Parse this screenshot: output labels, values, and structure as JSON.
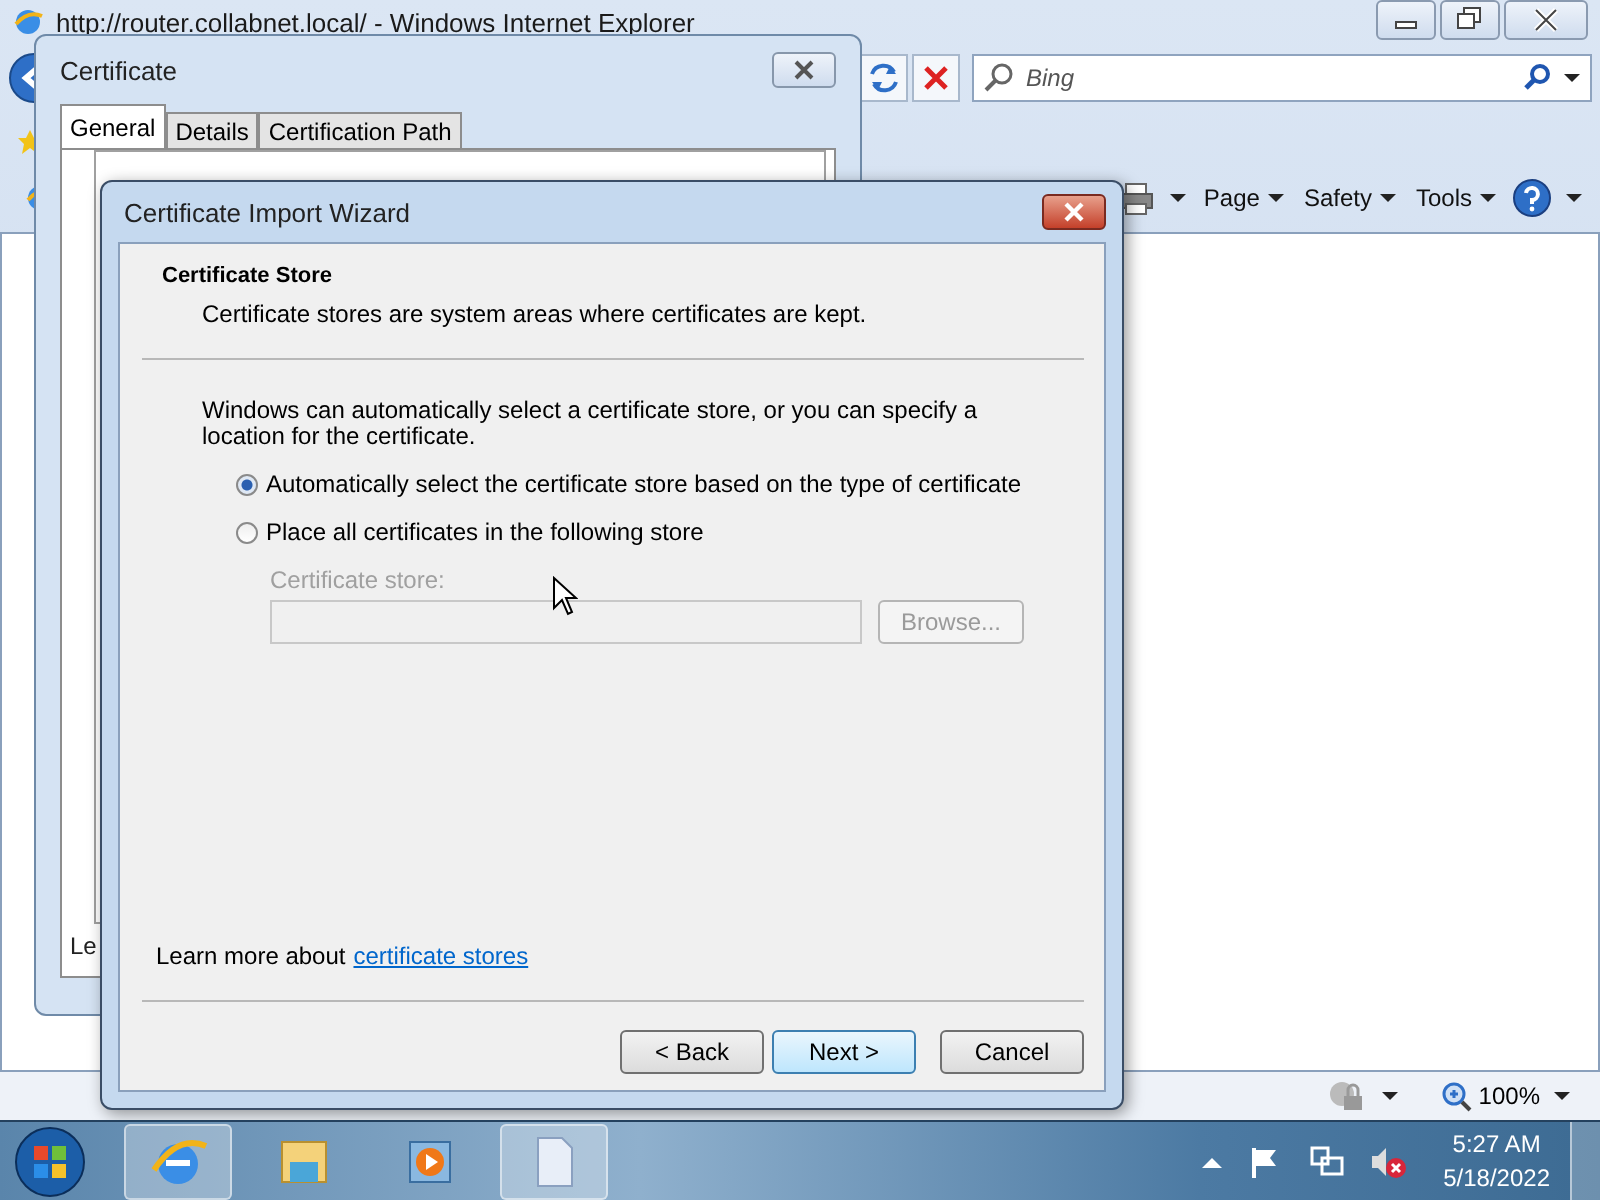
{
  "browser": {
    "title": "http://router.collabnet.local/ - Windows Internet Explorer",
    "search": {
      "placeholder": "Bing"
    },
    "commands": [
      {
        "label": "Page"
      },
      {
        "label": "Safety"
      },
      {
        "label": "Tools"
      }
    ],
    "zoom": "100%"
  },
  "certificate_dialog": {
    "title": "Certificate",
    "tabs": [
      {
        "label": "General",
        "selected": true
      },
      {
        "label": "Details",
        "selected": false
      },
      {
        "label": "Certification Path",
        "selected": false
      }
    ],
    "partial_text": "Le"
  },
  "wizard": {
    "title": "Certificate Import Wizard",
    "heading": "Certificate Store",
    "subtitle": "Certificate stores are system areas where certificates are kept.",
    "description": "Windows can automatically select a certificate store, or you can specify a location for the certificate.",
    "options": [
      {
        "label": "Automatically select the certificate store based on the type of certificate",
        "selected": true
      },
      {
        "label": "Place all certificates in the following store",
        "selected": false
      }
    ],
    "store_field": {
      "label": "Certificate store:",
      "disabled": true
    },
    "browse_button": {
      "label": "Browse...",
      "disabled": true
    },
    "learn_more": {
      "text": "Learn more about",
      "link": "certificate stores"
    },
    "buttons": [
      {
        "label": "< Back",
        "default": false
      },
      {
        "label": "Next >",
        "default": true
      },
      {
        "label": "Cancel",
        "default": false
      }
    ]
  },
  "taskbar": {
    "time": "5:27 AM",
    "date": "5/18/2022"
  }
}
